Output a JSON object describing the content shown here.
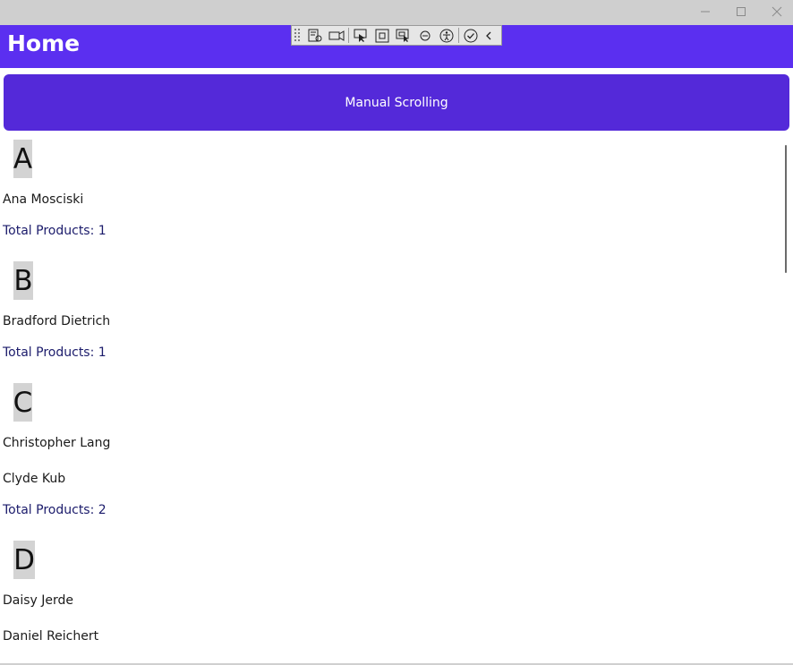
{
  "window": {
    "minimize_icon": "minimize-icon",
    "maximize_icon": "maximize-icon",
    "close_icon": "close-icon"
  },
  "header": {
    "title": "Home"
  },
  "devtools": {
    "tools": [
      "live-visual-tree-icon",
      "record-icon",
      "select-element-icon",
      "display-layout-adorners-icon",
      "track-focus-icon",
      "binding-failures-icon",
      "accessibility-checker-icon",
      "hot-reload-check-icon",
      "collapse-chevron-icon"
    ]
  },
  "manual_scrolling_button": {
    "label": "Manual Scrolling"
  },
  "groups": [
    {
      "letter": "A",
      "names": [
        "Ana Mosciski"
      ],
      "total": "Total Products: 1"
    },
    {
      "letter": "B",
      "names": [
        "Bradford Dietrich"
      ],
      "total": "Total Products: 1"
    },
    {
      "letter": "C",
      "names": [
        "Christopher Lang",
        "Clyde Kub"
      ],
      "total": "Total Products: 2"
    },
    {
      "letter": "D",
      "names": [
        "Daisy Jerde",
        "Daniel Reichert"
      ],
      "total": ""
    }
  ]
}
